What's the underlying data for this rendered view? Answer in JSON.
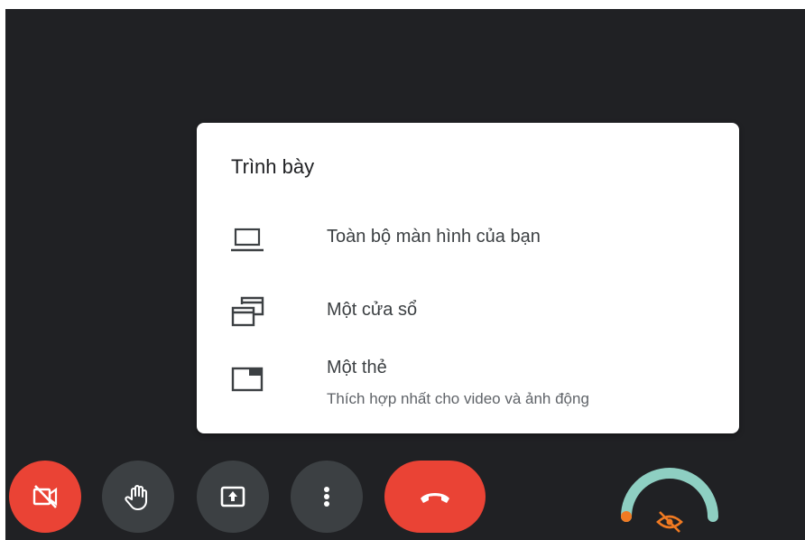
{
  "present_menu": {
    "title": "Trình bày",
    "items": [
      {
        "icon": "laptop-icon",
        "label": "Toàn bộ màn hình của bạn"
      },
      {
        "icon": "window-icon",
        "label": "Một cửa sổ"
      },
      {
        "icon": "tab-icon",
        "label": "Một thẻ",
        "sublabel": "Thích hợp nhất cho video và ảnh động"
      }
    ]
  },
  "controls": [
    {
      "name": "camera-off",
      "icon": "videocam-off-icon",
      "color": "#ea4335"
    },
    {
      "name": "raise-hand",
      "icon": "hand-icon",
      "color": "#3c4043"
    },
    {
      "name": "present",
      "icon": "present-screen-icon",
      "color": "#3c4043"
    },
    {
      "name": "more-options",
      "icon": "more-vertical-icon",
      "color": "#3c4043"
    },
    {
      "name": "leave-call",
      "icon": "call-end-icon",
      "color": "#ea4335"
    }
  ],
  "colors": {
    "background": "#202124",
    "menu_background": "#ffffff",
    "danger": "#ea4335",
    "control": "#3c4043",
    "gauge": "#8ecfc2",
    "accent_orange": "#f07a22"
  },
  "indicator": {
    "icon": "visibility-off-icon"
  }
}
